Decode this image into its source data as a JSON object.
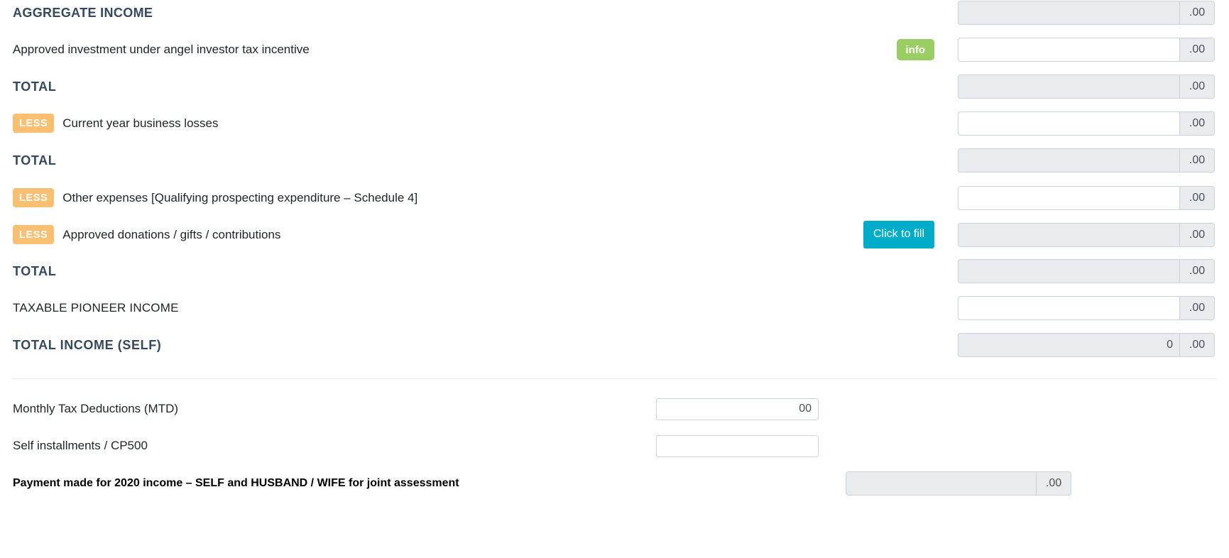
{
  "form": {
    "section_title": "AGGREGATE INCOME",
    "cents_suffix": ".00",
    "rows": [
      {
        "id": "aggregate-income",
        "label": "AGGREGATE INCOME",
        "style": "heading",
        "badge": null,
        "badge_label": "",
        "action": null,
        "action_label": "",
        "value": "",
        "readonly": true
      },
      {
        "id": "angel-investor-tax-incentive",
        "label": "Approved investment under angel investor tax incentive",
        "style": "normal",
        "badge": null,
        "badge_label": "",
        "action": "info",
        "action_label": "info",
        "value": "",
        "readonly": false
      },
      {
        "id": "total-1",
        "label": "TOTAL",
        "style": "total",
        "badge": null,
        "badge_label": "",
        "action": null,
        "action_label": "",
        "value": "",
        "readonly": true
      },
      {
        "id": "current-year-business-losses",
        "label": "Current year business losses",
        "style": "normal",
        "badge": "less",
        "badge_label": "LESS",
        "action": null,
        "action_label": "",
        "value": "",
        "readonly": false
      },
      {
        "id": "total-2",
        "label": "TOTAL",
        "style": "total",
        "badge": null,
        "badge_label": "",
        "action": null,
        "action_label": "",
        "value": "",
        "readonly": true
      },
      {
        "id": "other-expenses-schedule-4",
        "label": "Other expenses [Qualifying prospecting expenditure – Schedule 4]",
        "style": "normal",
        "badge": "less",
        "badge_label": "LESS",
        "action": null,
        "action_label": "",
        "value": "",
        "readonly": false
      },
      {
        "id": "approved-donations-gifts-contributions",
        "label": "Approved donations / gifts / contributions",
        "style": "normal",
        "badge": "less",
        "badge_label": "LESS",
        "action": "button",
        "action_label": "Click to fill",
        "value": "",
        "readonly": true
      },
      {
        "id": "total-3",
        "label": "TOTAL",
        "style": "total",
        "badge": null,
        "badge_label": "",
        "action": null,
        "action_label": "",
        "value": "",
        "readonly": true
      },
      {
        "id": "taxable-pioneer-income",
        "label": "TAXABLE PIONEER INCOME",
        "style": "plain-caps",
        "badge": null,
        "badge_label": "",
        "action": null,
        "action_label": "",
        "value": "",
        "readonly": false
      },
      {
        "id": "total-income-self",
        "label": "TOTAL INCOME (SELF)",
        "style": "total",
        "badge": null,
        "badge_label": "",
        "action": null,
        "action_label": "",
        "value": "0",
        "readonly": true
      }
    ],
    "payment_section": {
      "rows": [
        {
          "id": "monthly-tax-deductions",
          "label": "Monthly Tax Deductions (MTD)",
          "value": "00"
        },
        {
          "id": "self-installments-cp500",
          "label": "Self installments / CP500",
          "value": ""
        }
      ],
      "footer": {
        "id": "payment-made-2020",
        "text_part_1": "Payment made for 2020 income – ",
        "text_part_2": "SELF",
        "text_part_3": " and ",
        "text_part_4": "HUSBAND / WIFE",
        "text_part_5": " for joint assessment",
        "value": "",
        "cents_suffix": ".00"
      }
    }
  },
  "colors": {
    "badge_less": "#fbbf72",
    "badge_info": "#9acd62",
    "button_fill": "#00acc8",
    "heading_text": "#34495e",
    "readonly_bg": "#e9ecef",
    "field_border": "#ccd3da"
  }
}
